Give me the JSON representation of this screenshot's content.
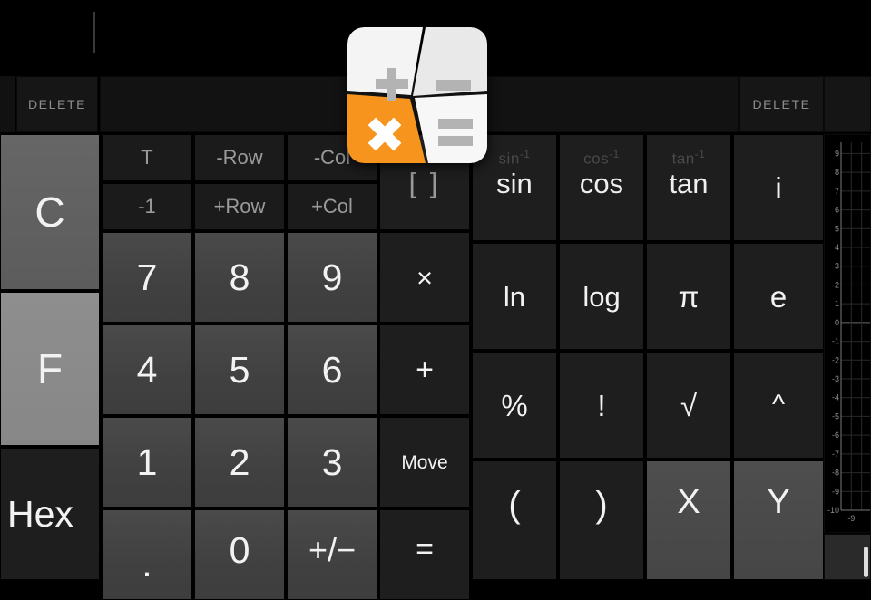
{
  "app": {
    "title": "Calculator",
    "icon_name": "calculator-app-icon"
  },
  "display": {
    "value": "",
    "caret_visible": true
  },
  "delete_row": {
    "left_label": "DELETE",
    "right_label": "DELETE",
    "middle_label": ""
  },
  "mode_column": [
    {
      "id": "clear",
      "label": "C",
      "style": "light"
    },
    {
      "id": "fkey",
      "label": "F",
      "style": "light2"
    },
    {
      "id": "hex",
      "label": "Hex",
      "style": "dark"
    }
  ],
  "matrix_keys": [
    {
      "id": "transpose",
      "label": "T"
    },
    {
      "id": "minus-row",
      "label": "-Row"
    },
    {
      "id": "minus-col",
      "label": "-Col"
    },
    {
      "id": "inverse",
      "label": "-1"
    },
    {
      "id": "plus-row",
      "label": "+Row"
    },
    {
      "id": "plus-col",
      "label": "+Col"
    }
  ],
  "bracket_key": {
    "id": "brackets",
    "label": "[ ]"
  },
  "numeric_keys": [
    {
      "id": "seven",
      "label": "7"
    },
    {
      "id": "eight",
      "label": "8"
    },
    {
      "id": "nine",
      "label": "9"
    },
    {
      "id": "four",
      "label": "4"
    },
    {
      "id": "five",
      "label": "5"
    },
    {
      "id": "six",
      "label": "6"
    },
    {
      "id": "one",
      "label": "1"
    },
    {
      "id": "two",
      "label": "2"
    },
    {
      "id": "three",
      "label": "3"
    },
    {
      "id": "dot",
      "label": "."
    },
    {
      "id": "zero",
      "label": "0"
    },
    {
      "id": "sign",
      "label": "+/−"
    }
  ],
  "operator_keys": [
    {
      "id": "multiply",
      "label": "×"
    },
    {
      "id": "plus",
      "label": "+"
    },
    {
      "id": "move",
      "label": "Move"
    },
    {
      "id": "equals",
      "label": "="
    }
  ],
  "function_keys": [
    {
      "id": "sin",
      "label": "sin",
      "sup": "sin",
      "sup_exp": "-1"
    },
    {
      "id": "cos",
      "label": "cos",
      "sup": "cos",
      "sup_exp": "-1"
    },
    {
      "id": "tan",
      "label": "tan",
      "sup": "tan",
      "sup_exp": "-1"
    },
    {
      "id": "imaginary",
      "label": "i",
      "sup": "",
      "sup_exp": ""
    },
    {
      "id": "ln",
      "label": "ln"
    },
    {
      "id": "log",
      "label": "log"
    },
    {
      "id": "pi",
      "label": "π"
    },
    {
      "id": "e",
      "label": "e"
    },
    {
      "id": "percent",
      "label": "%"
    },
    {
      "id": "factorial",
      "label": "!"
    },
    {
      "id": "sqrt",
      "label": "√"
    },
    {
      "id": "power",
      "label": "^"
    },
    {
      "id": "paren-open",
      "label": "("
    },
    {
      "id": "paren-close",
      "label": ")"
    },
    {
      "id": "var-x",
      "label": "X"
    },
    {
      "id": "var-y",
      "label": "Y"
    }
  ],
  "chart_data": {
    "type": "line",
    "title": "",
    "xlabel": "",
    "ylabel": "",
    "xlim": [
      -10,
      -7
    ],
    "ylim": [
      -10,
      9.6
    ],
    "grid": true,
    "y_ticks": [
      9,
      8,
      7,
      6,
      5,
      4,
      3,
      2,
      1,
      0,
      -1,
      -2,
      -3,
      -4,
      -5,
      -6,
      -7,
      -8,
      -9,
      -10
    ],
    "x_ticks": [
      -9
    ],
    "x_tick_labels": [
      "-9"
    ],
    "series": []
  },
  "colors": {
    "accent_orange": "#f7941e",
    "key_dark": "#1e1e1e",
    "key_num": "#444444",
    "key_light": "#626262",
    "key_light2": "#8b8b8b",
    "text": "#f2f2f2",
    "text_dim": "#8c8c8c",
    "background": "#000000"
  }
}
